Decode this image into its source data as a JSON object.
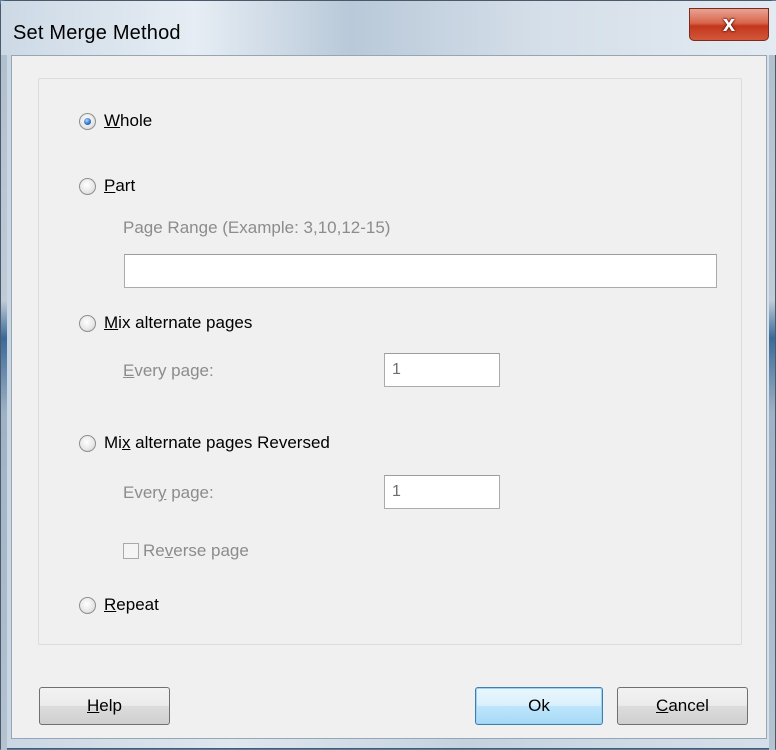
{
  "window": {
    "title": "Set Merge Method",
    "close_glyph": "x"
  },
  "options": {
    "whole": {
      "prefix": "",
      "key": "W",
      "rest": "hole",
      "checked": true
    },
    "part": {
      "prefix": "",
      "key": "P",
      "rest": "art",
      "checked": false
    },
    "mix": {
      "prefix": "",
      "key": "M",
      "rest": "ix alternate pages",
      "checked": false
    },
    "mix_reversed": {
      "prefix": "Mi",
      "key": "x",
      "rest": " alternate pages Reversed",
      "checked": false
    },
    "repeat": {
      "prefix": "",
      "key": "R",
      "rest": "epeat",
      "checked": false
    }
  },
  "part": {
    "range_label_a": "Page Ran",
    "range_label_key": "g",
    "range_label_b": "e (Example: 3,10,12-15)",
    "range_value": ""
  },
  "mix": {
    "every_key": "E",
    "every_rest": "very page:",
    "every_value": "1"
  },
  "mix_reversed": {
    "every_a": "Ever",
    "every_key": "y",
    "every_b": " page:",
    "every_value": "1",
    "reverse_a": "Re",
    "reverse_key": "v",
    "reverse_b": "erse page",
    "reverse_checked": false
  },
  "buttons": {
    "help_key": "H",
    "help_rest": "elp",
    "ok": "Ok",
    "cancel_key": "C",
    "cancel_rest": "ancel"
  },
  "icons": {
    "close": "close-icon",
    "radio": "radio-button",
    "checkbox": "checkbox"
  },
  "colors": {
    "dialog_bg": "#f0f0f0",
    "disabled_text": "#8c8c8c",
    "close_red": "#c2371c",
    "radio_dot": "#2a6cc9",
    "default_button_border": "#3c7fb1"
  }
}
